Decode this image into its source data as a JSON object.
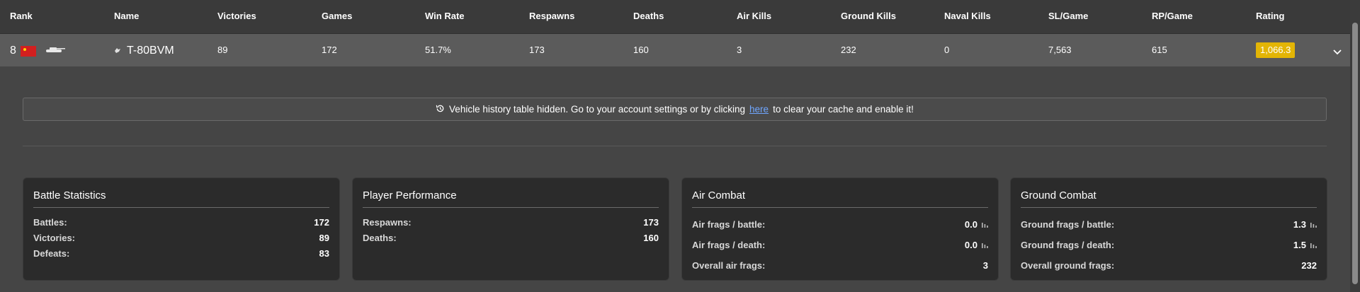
{
  "columns": [
    "Rank",
    "Name",
    "Victories",
    "Games",
    "Win Rate",
    "Respawns",
    "Deaths",
    "Air Kills",
    "Ground Kills",
    "Naval Kills",
    "SL/Game",
    "RP/Game",
    "Rating"
  ],
  "row": {
    "rank": "8",
    "name": "T-80BVM",
    "victories": "89",
    "games": "172",
    "win_rate": "51.7%",
    "respawns": "173",
    "deaths": "160",
    "air_kills": "3",
    "ground_kills": "232",
    "naval_kills": "0",
    "sl_game": "7,563",
    "rp_game": "615",
    "rating": "1,066.3",
    "flag_color": "#d21f1f",
    "rating_color": "#e3b505"
  },
  "notice": {
    "icon": "history-icon",
    "text_before": "Vehicle history table hidden. Go to your account settings or by clicking",
    "link": "here",
    "text_after": "to clear your cache and enable it!"
  },
  "cards": {
    "battle": {
      "title": "Battle Statistics",
      "battles_label": "Battles:",
      "battles": "172",
      "victories_label": "Victories:",
      "victories": "89",
      "defeats_label": "Defeats:",
      "defeats": "83"
    },
    "performance": {
      "title": "Player Performance",
      "respawns_label": "Respawns:",
      "respawns": "173",
      "deaths_label": "Deaths:",
      "deaths": "160"
    },
    "air": {
      "title": "Air Combat",
      "per_battle_label": "Air frags / battle:",
      "per_battle": "0.0",
      "per_death_label": "Air frags / death:",
      "per_death": "0.0",
      "overall_label": "Overall air frags:",
      "overall": "3"
    },
    "ground": {
      "title": "Ground Combat",
      "per_battle_label": "Ground frags / battle:",
      "per_battle": "1.3",
      "per_death_label": "Ground frags / death:",
      "per_death": "1.5",
      "overall_label": "Overall ground frags:",
      "overall": "232"
    }
  }
}
